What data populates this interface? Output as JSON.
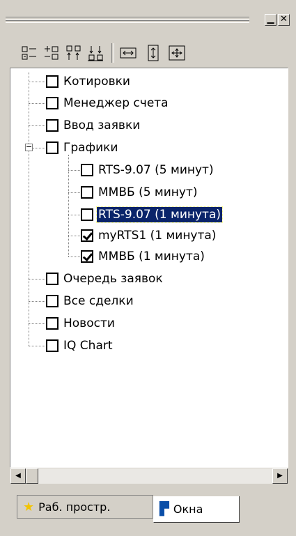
{
  "titlebar": {
    "minimize_icon": "▁",
    "close_icon": "✕"
  },
  "toolbar": {
    "buttons": [
      "expand-all-icon",
      "collapse-all-icon",
      "move-up-icon",
      "move-down-icon",
      "fit-width-icon",
      "fit-height-icon",
      "fit-both-icon"
    ]
  },
  "tree": {
    "items": [
      {
        "label": "Котировки",
        "checked": false
      },
      {
        "label": "Менеджер счета",
        "checked": false
      },
      {
        "label": "Ввод заявки",
        "checked": false
      },
      {
        "label": "Графики",
        "checked": false,
        "expanded": true,
        "children": [
          {
            "label": "RTS-9.07 (5 минут)",
            "checked": false
          },
          {
            "label": "ММВБ (5 минут)",
            "checked": false
          },
          {
            "label": "RTS-9.07 (1 минута)",
            "checked": false,
            "selected": true
          },
          {
            "label": "myRTS1 (1 минута)",
            "checked": true
          },
          {
            "label": "ММВБ (1 минута)",
            "checked": true
          }
        ]
      },
      {
        "label": "Очередь заявок",
        "checked": false
      },
      {
        "label": "Все сделки",
        "checked": false
      },
      {
        "label": "Новости",
        "checked": false
      },
      {
        "label": "IQ Chart",
        "checked": false
      }
    ],
    "expander_symbol": "−"
  },
  "scrollbar": {
    "left_arrow": "◀",
    "right_arrow": "▶"
  },
  "tabs": [
    {
      "label": "Раб. простр.",
      "icon": "star-icon",
      "glyph": "★",
      "active": false
    },
    {
      "label": "Окна",
      "icon": "window-icon",
      "glyph": "▛",
      "active": true
    }
  ],
  "colors": {
    "selection": "#0a246a",
    "face": "#d4d0c8"
  }
}
